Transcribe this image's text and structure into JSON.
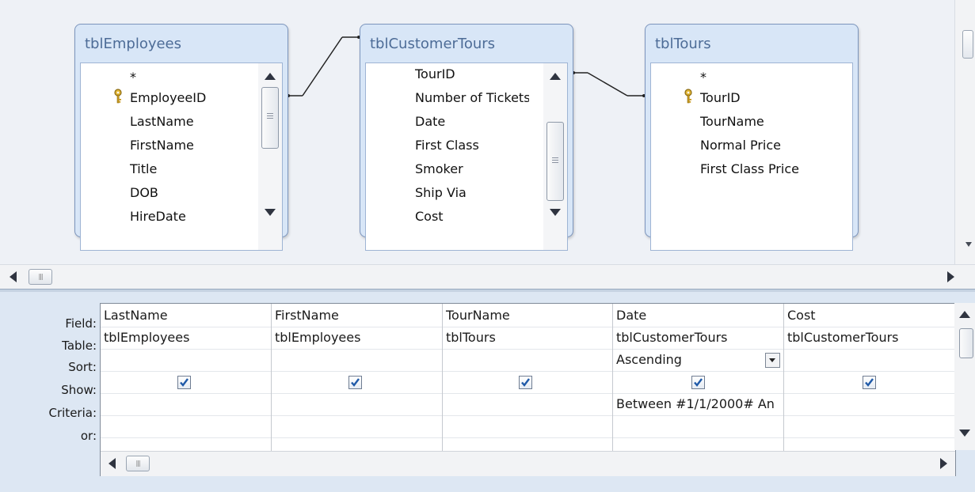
{
  "tables": [
    {
      "title": "tblEmployees",
      "fields": [
        "*",
        "EmployeeID",
        "LastName",
        "FirstName",
        "Title",
        "DOB",
        "HireDate"
      ],
      "key_field": "EmployeeID"
    },
    {
      "title": "tblCustomerTours",
      "fields": [
        "TourID",
        "Number of Tickets",
        "Date",
        "First Class",
        "Smoker",
        "Ship Via",
        "Cost"
      ]
    },
    {
      "title": "tblTours",
      "fields": [
        "*",
        "TourID",
        "TourName",
        "Normal Price",
        "First Class Price"
      ],
      "key_field": "TourID"
    }
  ],
  "grid": {
    "row_labels": {
      "field": "Field:",
      "table": "Table:",
      "sort": "Sort:",
      "show": "Show:",
      "criteria": "Criteria:",
      "or": "or:"
    },
    "columns": [
      {
        "field": "LastName",
        "table": "tblEmployees",
        "sort": "",
        "show": true,
        "criteria": ""
      },
      {
        "field": "FirstName",
        "table": "tblEmployees",
        "sort": "",
        "show": true,
        "criteria": ""
      },
      {
        "field": "TourName",
        "table": "tblTours",
        "sort": "",
        "show": true,
        "criteria": ""
      },
      {
        "field": "Date",
        "table": "tblCustomerTours",
        "sort": "Ascending",
        "show": true,
        "criteria": "Between #1/1/2000# An"
      },
      {
        "field": "Cost",
        "table": "tblCustomerTours",
        "sort": "",
        "show": true,
        "criteria": ""
      }
    ]
  },
  "icons": {
    "primary_key": "key-icon",
    "checkmark": "checkmark-icon",
    "dropdown": "chevron-down-icon"
  },
  "colors": {
    "window_border": "#7c95bd",
    "window_title": "#4d6c97",
    "pane_background": "#eef1f6",
    "grid_background": "#dde7f3",
    "checkbox_check": "#1f5aa8"
  }
}
